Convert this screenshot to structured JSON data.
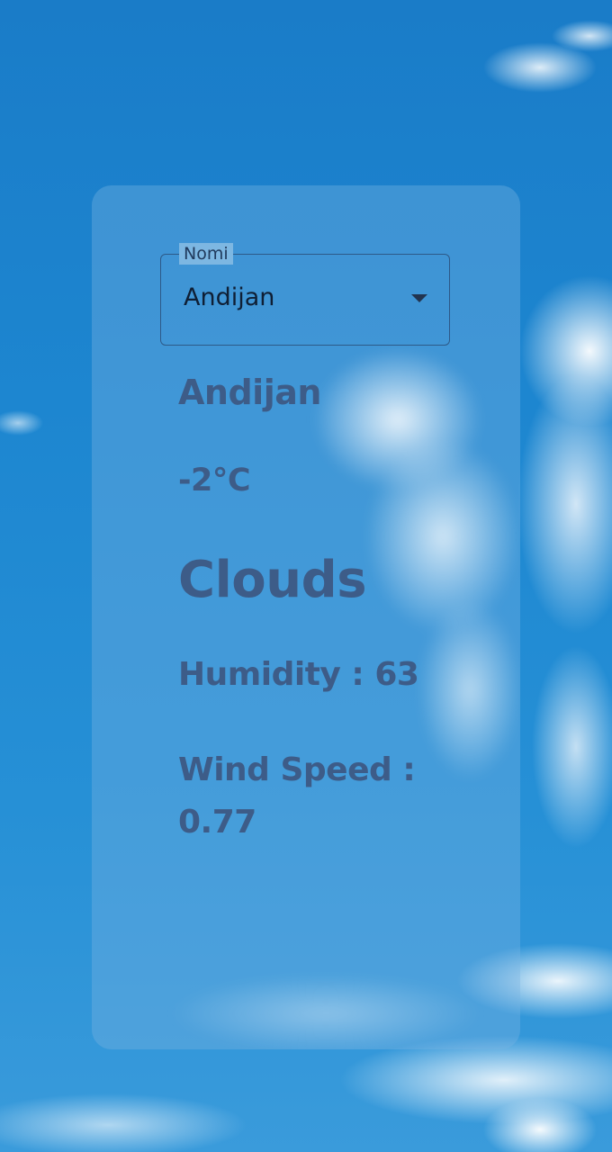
{
  "background": {
    "sky_color": "#1d86d0",
    "cloud_color": "#ffffff"
  },
  "card": {
    "dropdown": {
      "label": "Nomi",
      "selected": "Andijan",
      "caret_icon": "arrow-drop-down-icon"
    },
    "city": "Andijan",
    "temperature": "-2°C",
    "condition": "Clouds",
    "humidity_label": "Humidity : 63",
    "wind_label": "Wind Speed : 0.77",
    "text_color": "#3d5c88"
  }
}
